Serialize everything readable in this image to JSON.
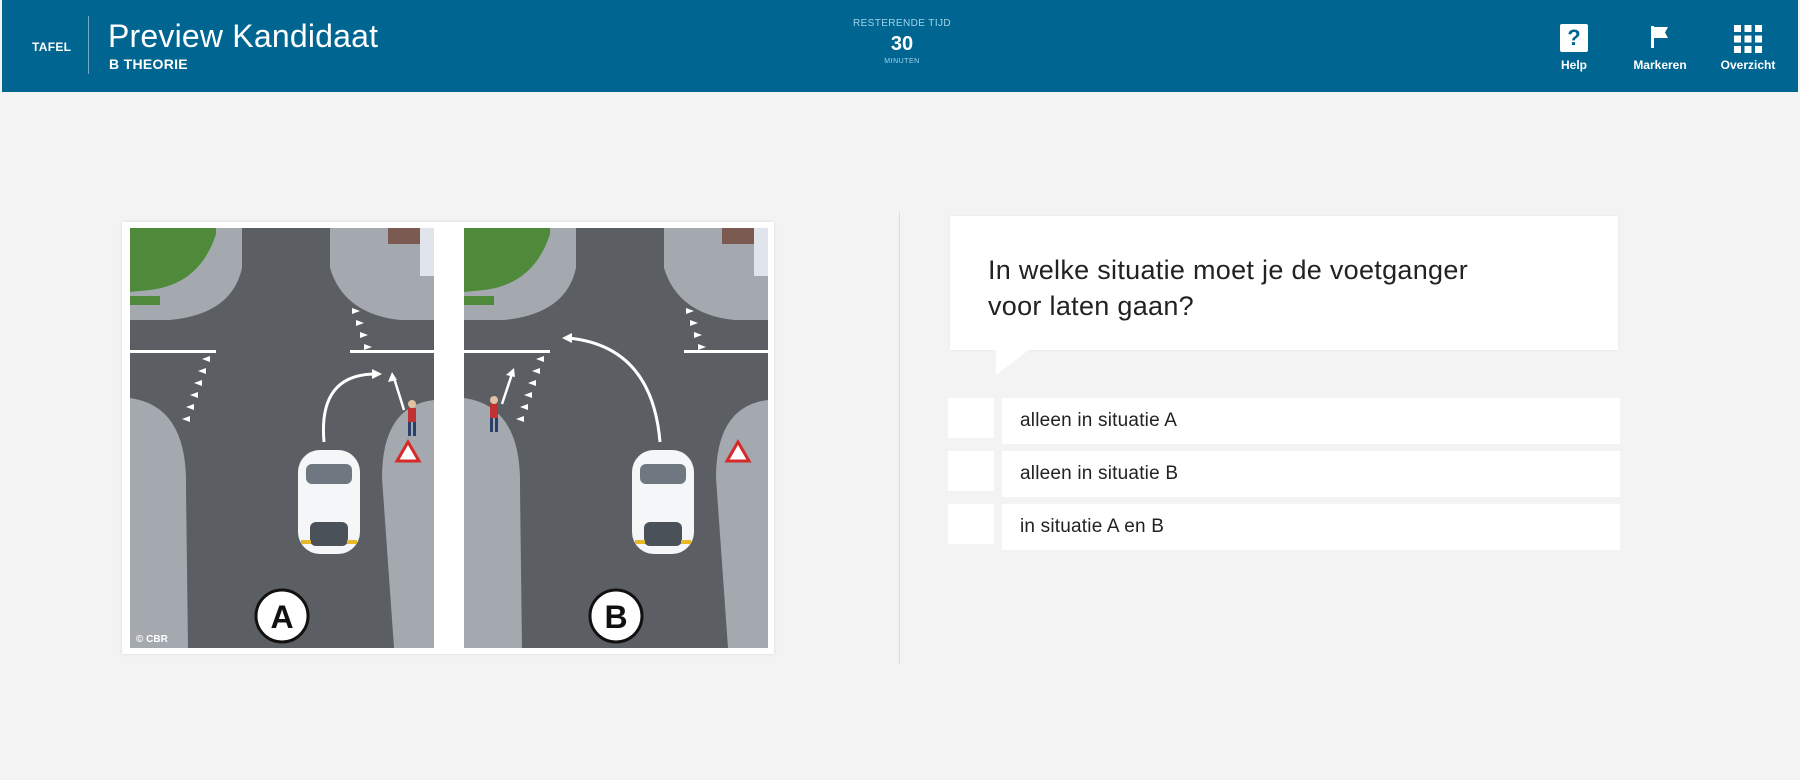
{
  "header": {
    "section": "TAFEL",
    "title": "Preview Kandidaat",
    "subtitle": "B THEORIE",
    "timer": {
      "label": "RESTERENDE TIJD",
      "value": "30",
      "unit": "MINUTEN"
    },
    "buttons": [
      {
        "label": "Help",
        "icon": "help-icon"
      },
      {
        "label": "Markeren",
        "icon": "flag-icon"
      },
      {
        "label": "Overzicht",
        "icon": "grid-icon"
      }
    ]
  },
  "illustration": {
    "panels": [
      {
        "label": "A"
      },
      {
        "label": "B"
      }
    ],
    "copyright": "© CBR",
    "colors": {
      "road": "#5b5e63",
      "sidewalk": "#a3a9ae",
      "grass": "#4f8a3a",
      "car": "#f4f6f8"
    }
  },
  "question": {
    "text_line1": "In welke situatie moet je de voetganger",
    "text_line2": "voor laten gaan?"
  },
  "answers": [
    {
      "text": "alleen in situatie A"
    },
    {
      "text": "alleen in situatie B"
    },
    {
      "text": "in situatie A en B"
    }
  ],
  "colors": {
    "header": "#006691",
    "background": "#f3f3f3"
  }
}
